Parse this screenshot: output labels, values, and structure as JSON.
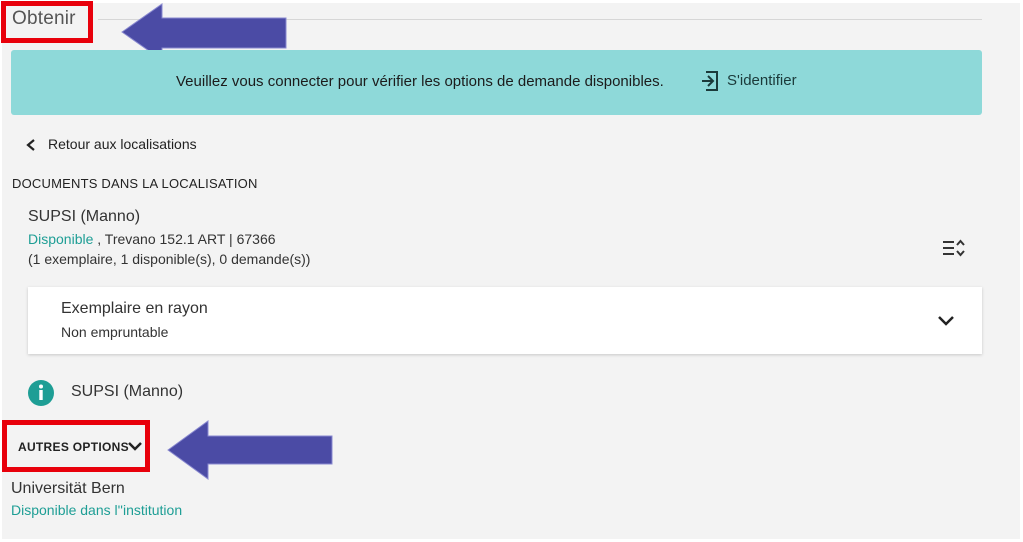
{
  "section": {
    "title": "Obtenir"
  },
  "banner": {
    "message": "Veuillez vous connecter pour vérifier les options de demande disponibles.",
    "login_label": "S'identifier",
    "login_icon": "sign-in-icon"
  },
  "back": {
    "label": "Retour aux localisations",
    "icon": "chevron-left-icon"
  },
  "documents": {
    "heading": "DOCUMENTS DANS LA LOCALISATION",
    "location_name": "SUPSI (Manno)",
    "status": "Disponible",
    "call_number": " , Trevano 152.1 ART | 67366",
    "summary": "(1 exemplaire, 1 disponible(s), 0 demande(s))",
    "sort_icon": "sort-icon"
  },
  "item": {
    "title": "Exemplaire en rayon",
    "subtitle": "Non empruntable",
    "expand_icon": "chevron-down-icon"
  },
  "info": {
    "label": "SUPSI (Manno)",
    "icon": "info-icon"
  },
  "other_options": {
    "label": "AUTRES OPTIONS",
    "icon": "chevron-down-icon"
  },
  "institution": {
    "name": "Universität Bern",
    "status": "Disponible dans l''institution"
  },
  "colors": {
    "accent": "#1e9e95",
    "banner": "#8ed9d9",
    "highlight_box": "#e8000b",
    "annotation_arrow": "#4b4ba5"
  }
}
